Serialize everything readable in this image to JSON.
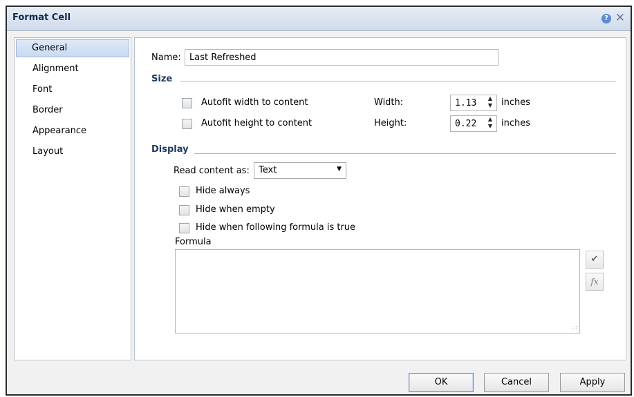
{
  "dialog": {
    "title": "Format Cell"
  },
  "sidebar": {
    "items": [
      {
        "label": "General"
      },
      {
        "label": "Alignment"
      },
      {
        "label": "Font"
      },
      {
        "label": "Border"
      },
      {
        "label": "Appearance"
      },
      {
        "label": "Layout"
      }
    ],
    "selected": "General"
  },
  "general": {
    "name_label": "Name:",
    "name_value": "Last Refreshed",
    "size_section": "Size",
    "autofit_width_label": "Autofit width to content",
    "autofit_height_label": "Autofit height to content",
    "width_label": "Width:",
    "width_value": "1.13",
    "width_unit": "inches",
    "height_label": "Height:",
    "height_value": "0.22",
    "height_unit": "inches",
    "display_section": "Display",
    "read_content_label": "Read content as:",
    "read_content_value": "Text",
    "hide_always_label": "Hide always",
    "hide_empty_label": "Hide when empty",
    "hide_formula_label": "Hide when following formula is true",
    "formula_label": "Formula",
    "formula_value": ""
  },
  "buttons": {
    "ok": "OK",
    "cancel": "Cancel",
    "apply": "Apply"
  },
  "icons": {
    "help": "help-icon",
    "close": "close-icon",
    "validate": "checkmark-icon",
    "function": "fx-icon"
  }
}
